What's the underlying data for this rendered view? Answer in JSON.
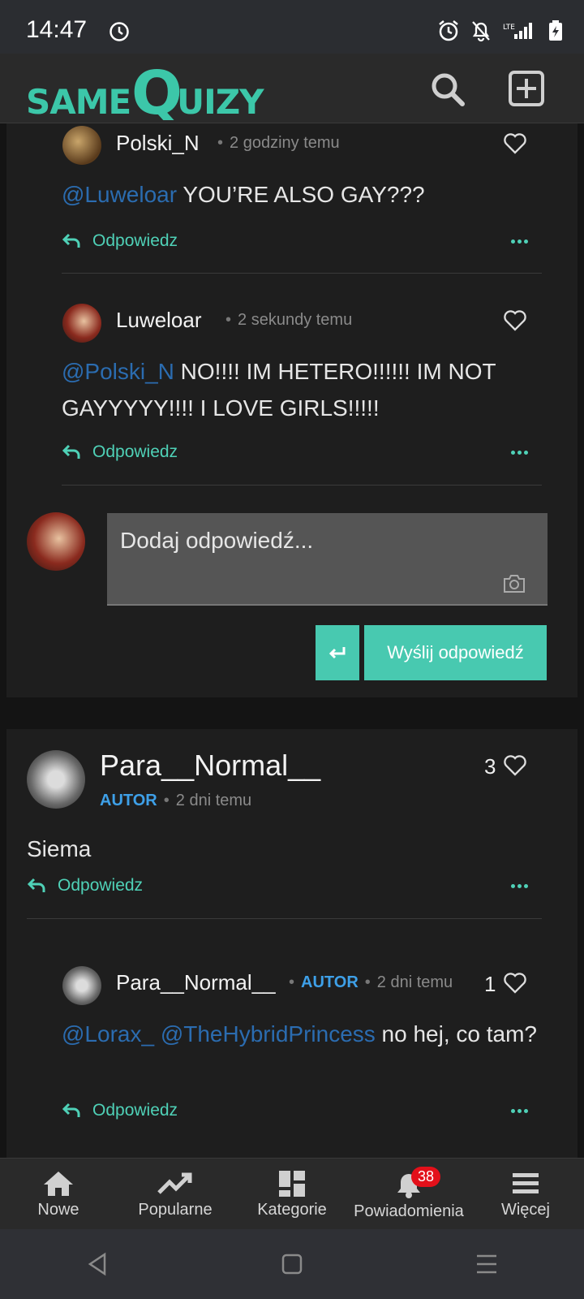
{
  "status": {
    "time": "14:47"
  },
  "header": {
    "logo_same": "SAME",
    "logo_quizy": "QUIZY"
  },
  "thread1": {
    "replies": [
      {
        "user": "Polski_N",
        "time": "2 godziny temu",
        "mention": "@Luweloar",
        "text": " YOU’RE ALSO GAY???",
        "reply_label": "Odpowiedz"
      },
      {
        "user": "Luweloar",
        "time": "2 sekundy temu",
        "mention": "@Polski_N",
        "text": " NO!!!! IM HETERO!!!!!! IM NOT GAYYYYY!!!! I LOVE GIRLS!!!!!",
        "reply_label": "Odpowiedz"
      }
    ],
    "input_placeholder": "Dodaj odpowiedź...",
    "send_label": "Wyślij odpowiedź"
  },
  "comment2": {
    "user": "Para__Normal__",
    "badge": "AUTOR",
    "time": "2 dni temu",
    "likes": "3",
    "text": "Siema",
    "reply_label": "Odpowiedz",
    "reply": {
      "user": "Para__Normal__",
      "badge": "AUTOR",
      "time": "2 dni temu",
      "likes": "1",
      "mention": "@Lorax_ @TheHybridPrincess",
      "text": " no hej, co tam?",
      "reply_label": "Odpowiedz"
    }
  },
  "bottom_nav": {
    "items": [
      {
        "label": "Nowe",
        "icon": "home-icon"
      },
      {
        "label": "Popularne",
        "icon": "trending-icon"
      },
      {
        "label": "Kategorie",
        "icon": "grid-icon"
      },
      {
        "label": "Powiadomienia",
        "icon": "bell-icon",
        "badge": "38"
      },
      {
        "label": "Więcej",
        "icon": "menu-icon"
      }
    ]
  },
  "colors": {
    "accent": "#48c9b0",
    "mention": "#2b6cb0",
    "author": "#3ea0e8",
    "badge": "#e3101a"
  }
}
